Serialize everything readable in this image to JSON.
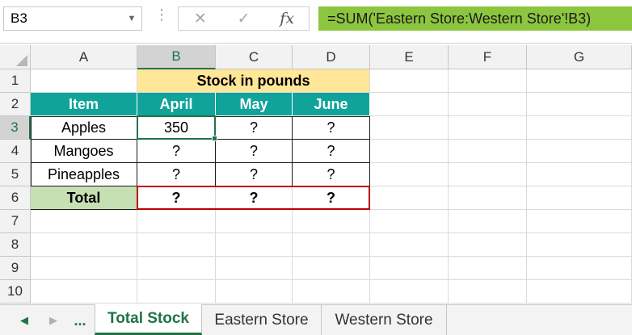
{
  "formula_bar": {
    "name_box": "B3",
    "cancel_icon": "✕",
    "enter_icon": "✓",
    "function_icon": "fx",
    "formula": "=SUM('Eastern Store:Western Store'!B3)"
  },
  "columns": [
    "A",
    "B",
    "C",
    "D",
    "E",
    "F",
    "G"
  ],
  "rows": [
    "1",
    "2",
    "3",
    "4",
    "5",
    "6",
    "7",
    "8",
    "9",
    "10"
  ],
  "sheet": {
    "title": "Stock in pounds",
    "headers": [
      "Item",
      "April",
      "May",
      "June"
    ],
    "items": [
      {
        "name": "Apples",
        "values": [
          "350",
          "?",
          "?"
        ]
      },
      {
        "name": "Mangoes",
        "values": [
          "?",
          "?",
          "?"
        ]
      },
      {
        "name": "Pineapples",
        "values": [
          "?",
          "?",
          "?"
        ]
      }
    ],
    "total": {
      "label": "Total",
      "values": [
        "?",
        "?",
        "?"
      ]
    }
  },
  "selected": {
    "column": "B",
    "row": "3"
  },
  "tabs": {
    "ellipsis": "...",
    "items": [
      "Total Stock",
      "Eastern Store",
      "Western Store"
    ],
    "active": "Total Stock"
  },
  "colors": {
    "title_fill": "#ffe699",
    "header_fill": "#0fa39a",
    "total_label_fill": "#c6e0b4",
    "formula_bar_fill": "#8cc63f",
    "total_border": "#c00000",
    "excel_green": "#217346"
  }
}
